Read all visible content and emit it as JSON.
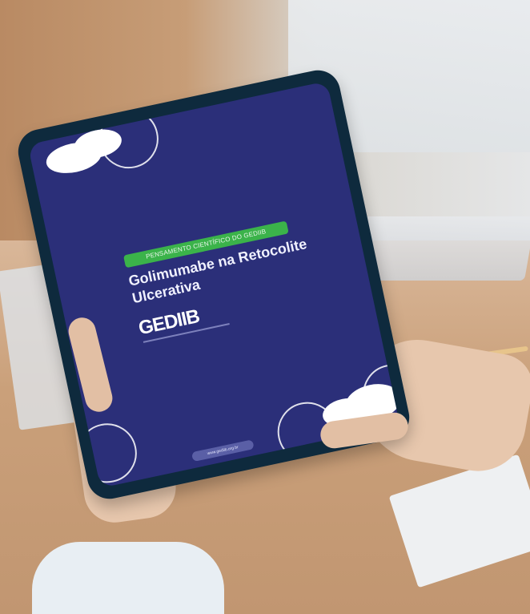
{
  "tablet": {
    "badge_text": "PENSAMENTO CIENTÍFICO DO GEDIIB",
    "title": "Golimumabe na Retocolite Ulcerativa",
    "logo_text": "GEDIIB",
    "url_text": "www.gediib.org.br"
  },
  "colors": {
    "screen": "#2b2f79",
    "badge": "#3bb34a",
    "frame": "#0e2a3d",
    "text": "#ffffff"
  }
}
